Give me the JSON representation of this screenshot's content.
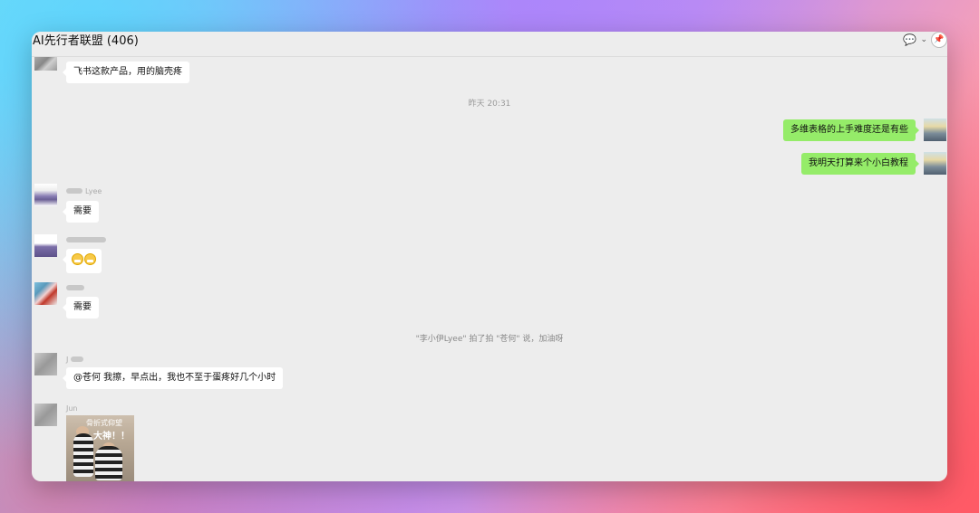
{
  "window": {
    "title": "AI先行者联盟 (406)"
  },
  "toolbar": {
    "chat_icon": "chat-bubble-icon",
    "caret_icon": "chevron-down-icon",
    "pin_icon": "pin-icon"
  },
  "messages": {
    "m1": {
      "text": "飞书这款产品，用的脑壳疼"
    },
    "time1": {
      "text": "昨天 20:31"
    },
    "m2": {
      "text": "多维表格的上手难度还是有些"
    },
    "m3": {
      "text": "我明天打算来个小白教程"
    },
    "m4": {
      "sender": "Lyee",
      "text": "需要"
    },
    "m5": {
      "text": "😁😁"
    },
    "m6": {
      "text": "需要"
    },
    "sys1": {
      "text": "\"李小伊Lyee\" 拍了拍 \"苍何\" 说，加油呀"
    },
    "m7": {
      "sender": "J",
      "text": "@苍何 我擦，早点出，我也不至于蛋疼好几个小时"
    },
    "m8": {
      "sender": "Jun",
      "caption1": "骨折式仰望",
      "caption2": "大神！！"
    }
  },
  "colors": {
    "bubble_out": "#95ec69",
    "bubble_in": "#ffffff",
    "window_bg": "#ededed"
  }
}
